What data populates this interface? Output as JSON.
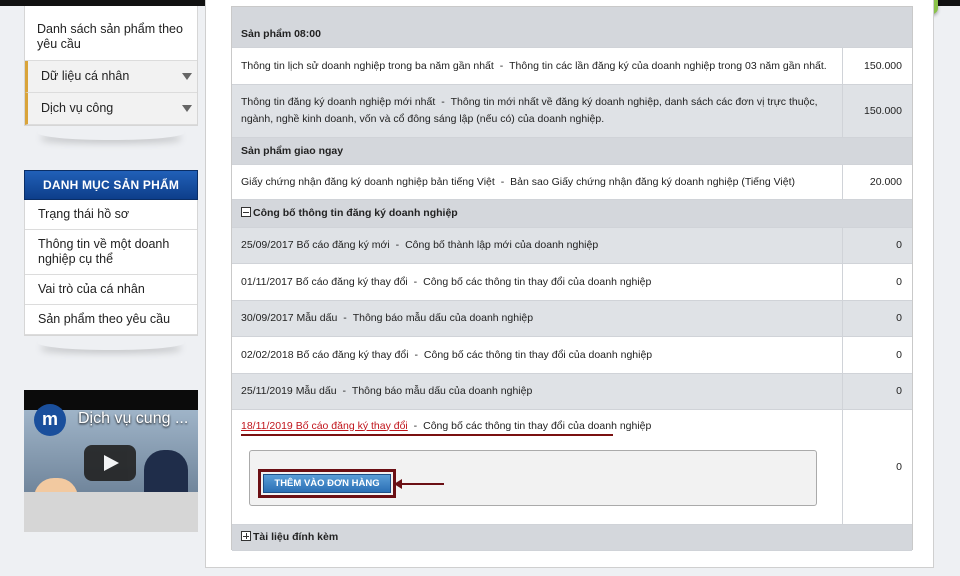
{
  "sidebar": {
    "menu": [
      {
        "label": "Danh sách sản phẩm theo yêu cầu",
        "type": "link"
      },
      {
        "label": "Dữ liệu cá nhân",
        "type": "dropdown"
      },
      {
        "label": "Dịch vụ công",
        "type": "dropdown"
      }
    ],
    "category_title": "DANH MỤC SẢN PHẨM",
    "categories": [
      "Trạng thái hồ sơ",
      "Thông tin về một doanh nghiệp cụ thể",
      "Vai trò của cá nhân",
      "Sản phẩm theo yêu cầu"
    ],
    "video": {
      "logo_letter": "m",
      "title": "Dịch vụ cung ..."
    }
  },
  "products": {
    "section1_title": "Sản phẩm 08:00",
    "section1_rows": [
      {
        "name": "Thông tin lịch sử doanh nghiệp trong ba năm gần nhất",
        "desc": "Thông tin các lần đăng ký của doanh nghiệp trong 03 năm gần nhất.",
        "price": "150.000"
      },
      {
        "name": "Thông tin đăng ký doanh nghiệp mới nhất",
        "desc": "Thông tin mới nhất về đăng ký doanh nghiệp, danh sách các đơn vị trực thuộc, ngành, nghề kinh doanh, vốn và cổ đông sáng lập (nếu có) của doanh nghiệp.",
        "price": "150.000"
      }
    ],
    "section2_title": "Sản phẩm giao ngay",
    "section2_rows": [
      {
        "name": "Giấy chứng nhận đăng ký doanh nghiệp bản tiếng Việt",
        "desc": "Bản sao Giấy chứng nhận đăng ký doanh nghiệp (Tiếng Việt)",
        "price": "20.000"
      }
    ],
    "section3_title": "Công bố thông tin đăng ký doanh nghiệp",
    "section3_rows": [
      {
        "name": "25/09/2017 Bố cáo đăng ký mới",
        "desc": "Công bố thành lập mới của doanh nghiệp",
        "price": "0"
      },
      {
        "name": "01/11/2017 Bố cáo đăng ký thay đổi",
        "desc": "Công bố các thông tin thay đổi của doanh nghiệp",
        "price": "0"
      },
      {
        "name": "30/09/2017 Mẫu dấu",
        "desc": "Thông báo mẫu dấu của doanh nghiệp",
        "price": "0"
      },
      {
        "name": "02/02/2018 Bố cáo đăng ký thay đổi",
        "desc": "Công bố các thông tin thay đổi của doanh nghiệp",
        "price": "0"
      },
      {
        "name": "25/11/2019 Mẫu dấu",
        "desc": "Thông báo mẫu dấu của doanh nghiệp",
        "price": "0"
      }
    ],
    "selected_row": {
      "name": "18/11/2019 Bố cáo đăng ký thay đổi",
      "desc": "Công bố các thông tin thay đổi của doanh nghiệp",
      "price": "0"
    },
    "add_to_order_label": "THÊM VÀO ĐƠN HÀNG",
    "attachments_title": "Tài liệu đính kèm"
  },
  "colors": {
    "category_header": "#1a55a8",
    "selected_title": "#c0141b",
    "highlight_outline": "#6b0f14"
  }
}
